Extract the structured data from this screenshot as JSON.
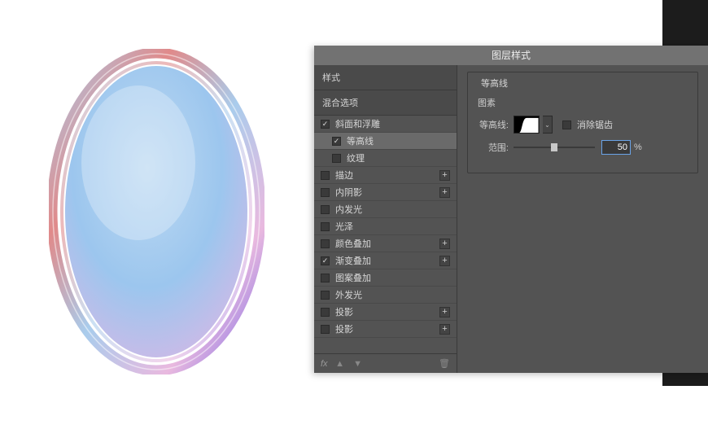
{
  "dialog": {
    "title": "图层样式",
    "sidebar": {
      "heading_styles": "样式",
      "heading_blend": "混合选项",
      "items": [
        {
          "label": "斜面和浮雕",
          "checked": true,
          "sub": false,
          "hasPlus": false,
          "selected": false
        },
        {
          "label": "等高线",
          "checked": true,
          "sub": true,
          "hasPlus": false,
          "selected": true
        },
        {
          "label": "纹理",
          "checked": false,
          "sub": true,
          "hasPlus": false,
          "selected": false
        },
        {
          "label": "描边",
          "checked": false,
          "sub": false,
          "hasPlus": true,
          "selected": false
        },
        {
          "label": "内阴影",
          "checked": false,
          "sub": false,
          "hasPlus": true,
          "selected": false
        },
        {
          "label": "内发光",
          "checked": false,
          "sub": false,
          "hasPlus": false,
          "selected": false
        },
        {
          "label": "光泽",
          "checked": false,
          "sub": false,
          "hasPlus": false,
          "selected": false
        },
        {
          "label": "颜色叠加",
          "checked": false,
          "sub": false,
          "hasPlus": true,
          "selected": false
        },
        {
          "label": "渐变叠加",
          "checked": true,
          "sub": false,
          "hasPlus": true,
          "selected": false
        },
        {
          "label": "图案叠加",
          "checked": false,
          "sub": false,
          "hasPlus": false,
          "selected": false
        },
        {
          "label": "外发光",
          "checked": false,
          "sub": false,
          "hasPlus": false,
          "selected": false
        },
        {
          "label": "投影",
          "checked": false,
          "sub": false,
          "hasPlus": true,
          "selected": false
        },
        {
          "label": "投影",
          "checked": false,
          "sub": false,
          "hasPlus": true,
          "selected": false
        }
      ],
      "footer_fx": "fx"
    },
    "content": {
      "panel_title": "等高线",
      "elements_label": "图素",
      "contour_label": "等高线:",
      "antialias_label": "消除锯齿",
      "antialias_checked": false,
      "range_label": "范围:",
      "range_value": "50",
      "range_unit": "%"
    }
  }
}
